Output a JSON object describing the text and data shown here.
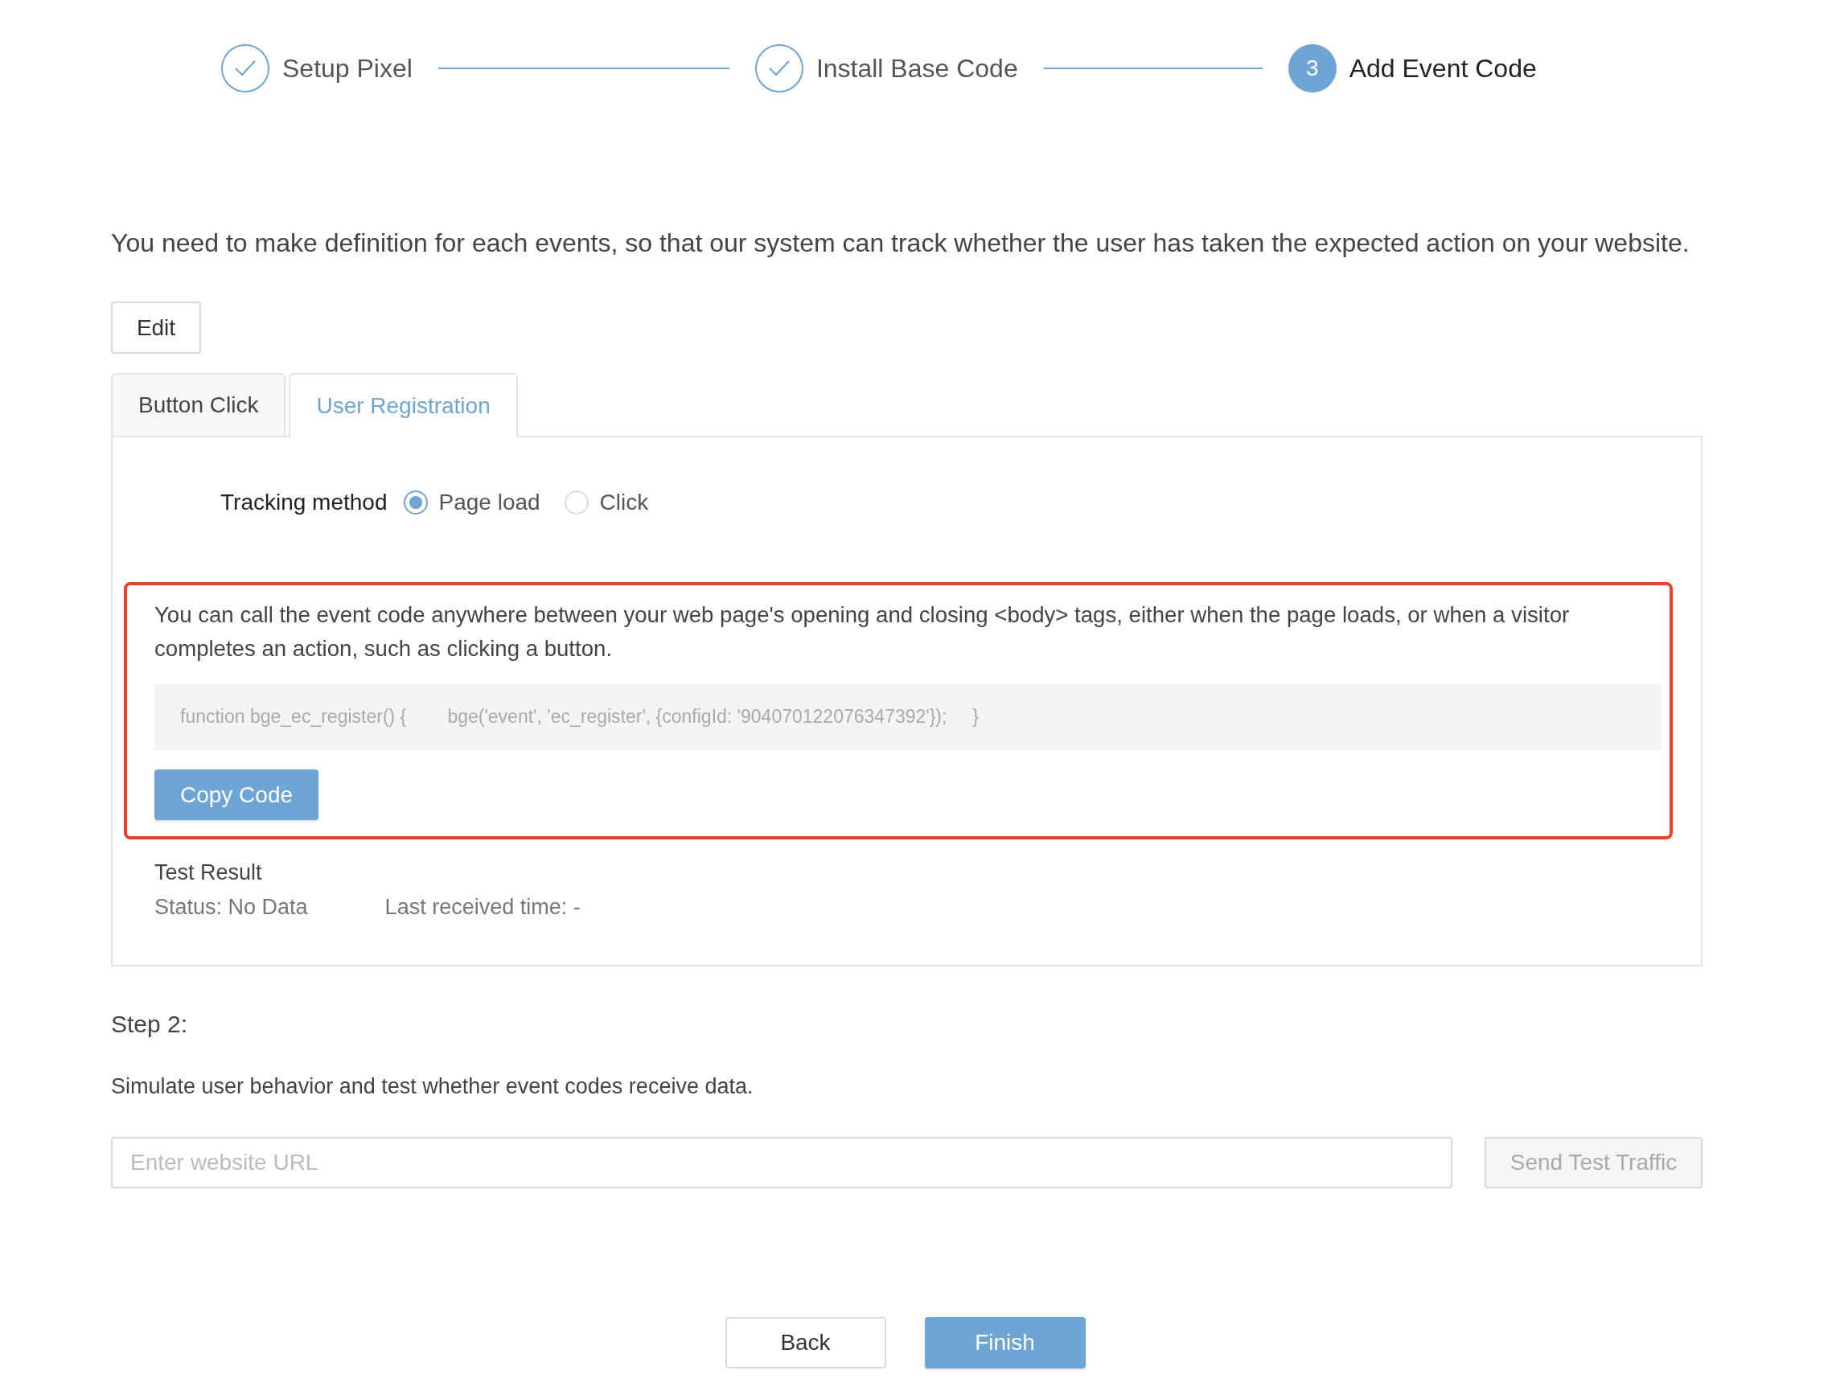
{
  "steps": [
    {
      "label": "Setup Pixel",
      "kind": "done"
    },
    {
      "label": "Install Base Code",
      "kind": "done"
    },
    {
      "label": "Add Event Code",
      "kind": "active",
      "number": "3"
    }
  ],
  "intro": "You need to make definition for each events, so that our system can track whether the user has taken the expected action on your website.",
  "edit_button": "Edit",
  "tabs": [
    {
      "label": "Button Click",
      "selected": false
    },
    {
      "label": "User Registration",
      "selected": true
    }
  ],
  "tracking": {
    "label": "Tracking method",
    "options": [
      {
        "label": "Page load",
        "selected": true
      },
      {
        "label": "Click",
        "selected": false
      }
    ]
  },
  "code_section": {
    "highlighted": true,
    "description": "You can call the event code anywhere between your web page's opening and closing <body> tags, either when the page loads, or when a visitor completes an action, such as clicking a button.",
    "code": "function bge_ec_register() {        bge('event', 'ec_register', {configId: '904070122076347392'});     }",
    "copy_button": "Copy Code"
  },
  "test_result": {
    "title": "Test Result",
    "status": "Status: No Data",
    "last_received": "Last received time: -"
  },
  "step2": {
    "title": "Step 2:",
    "description": "Simulate user behavior and test whether event codes receive data.",
    "url_field": {
      "placeholder": "Enter website URL"
    },
    "send_button": {
      "label": "Send Test Traffic",
      "disabled": true
    }
  },
  "footer_buttons": [
    {
      "label": "Back",
      "kind": "secondary"
    },
    {
      "label": "Finish",
      "kind": "primary"
    }
  ]
}
